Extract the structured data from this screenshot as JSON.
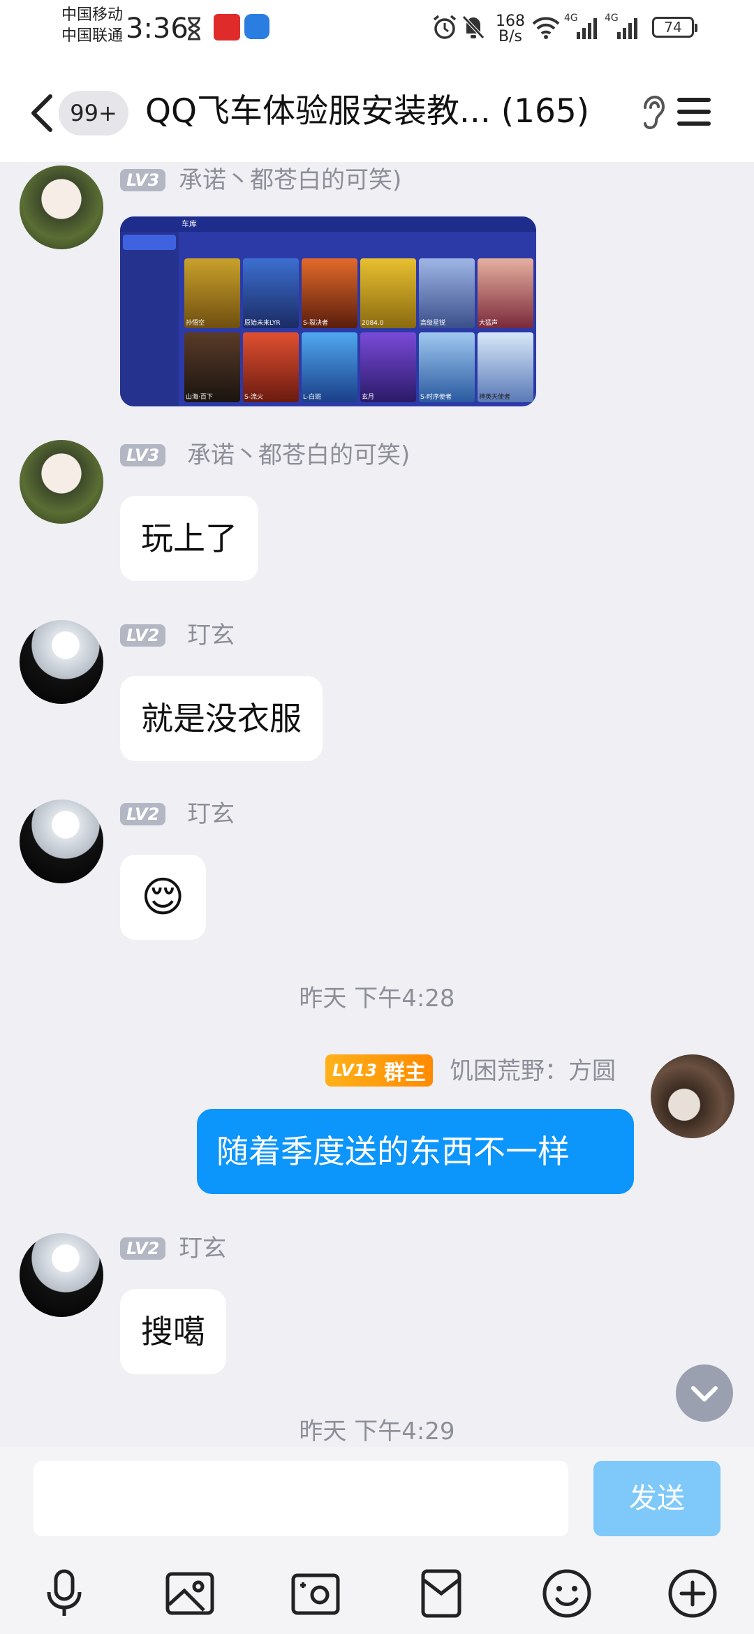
{
  "status_bar": {
    "carrier_1": "中国移动",
    "carrier_2": "中国联通",
    "time": "3:36",
    "net_speed_value": "168",
    "net_speed_unit": "B/s",
    "signal_1_label": "4G",
    "signal_2_label": "4G",
    "battery": "74"
  },
  "header": {
    "unread_badge": "99+",
    "title": "QQ飞车体验服安装教... (165)"
  },
  "messages": [
    {
      "level": "LV3",
      "sender": "承诺丶都苍白的可笑)",
      "type": "image",
      "image_labels": {
        "garage_tab": "车库",
        "cars": [
          "孙悟空",
          "原始未来LYR",
          "S-裂决者",
          "2084.0",
          "高级星锐",
          "大猛声",
          "山海·百下",
          "S-流火",
          "L-白斑",
          "玄月",
          "S-时序使者",
          "神英天使者"
        ]
      }
    },
    {
      "level": "LV3",
      "sender": "承诺丶都苍白的可笑)",
      "text": "玩上了"
    },
    {
      "level": "LV2",
      "sender": "玎玄",
      "text": "就是没衣服"
    },
    {
      "level": "LV2",
      "sender": "玎玄",
      "text": "😌"
    },
    {
      "timestamp": "昨天 下午4:28"
    },
    {
      "level": "LV13",
      "role": "群主",
      "sender": "饥困荒野：方圆",
      "text": "随着季度送的东西不一样",
      "self": true
    },
    {
      "level": "LV2",
      "sender": "玎玄",
      "text": "搜噶"
    },
    {
      "timestamp": "昨天 下午4:29"
    }
  ],
  "input": {
    "placeholder": "",
    "send_label": "发送"
  },
  "colors": {
    "accent": "#0c95fb",
    "send_disabled": "#7fc9fa",
    "owner_badge": "#ffa31a",
    "level_badge": "#b3b7c4"
  },
  "icons": [
    "microphone-icon",
    "image-icon",
    "camera-icon",
    "red-packet-icon",
    "emoji-icon",
    "plus-icon",
    "back-icon",
    "ear-icon",
    "menu-icon",
    "scroll-down-icon"
  ]
}
